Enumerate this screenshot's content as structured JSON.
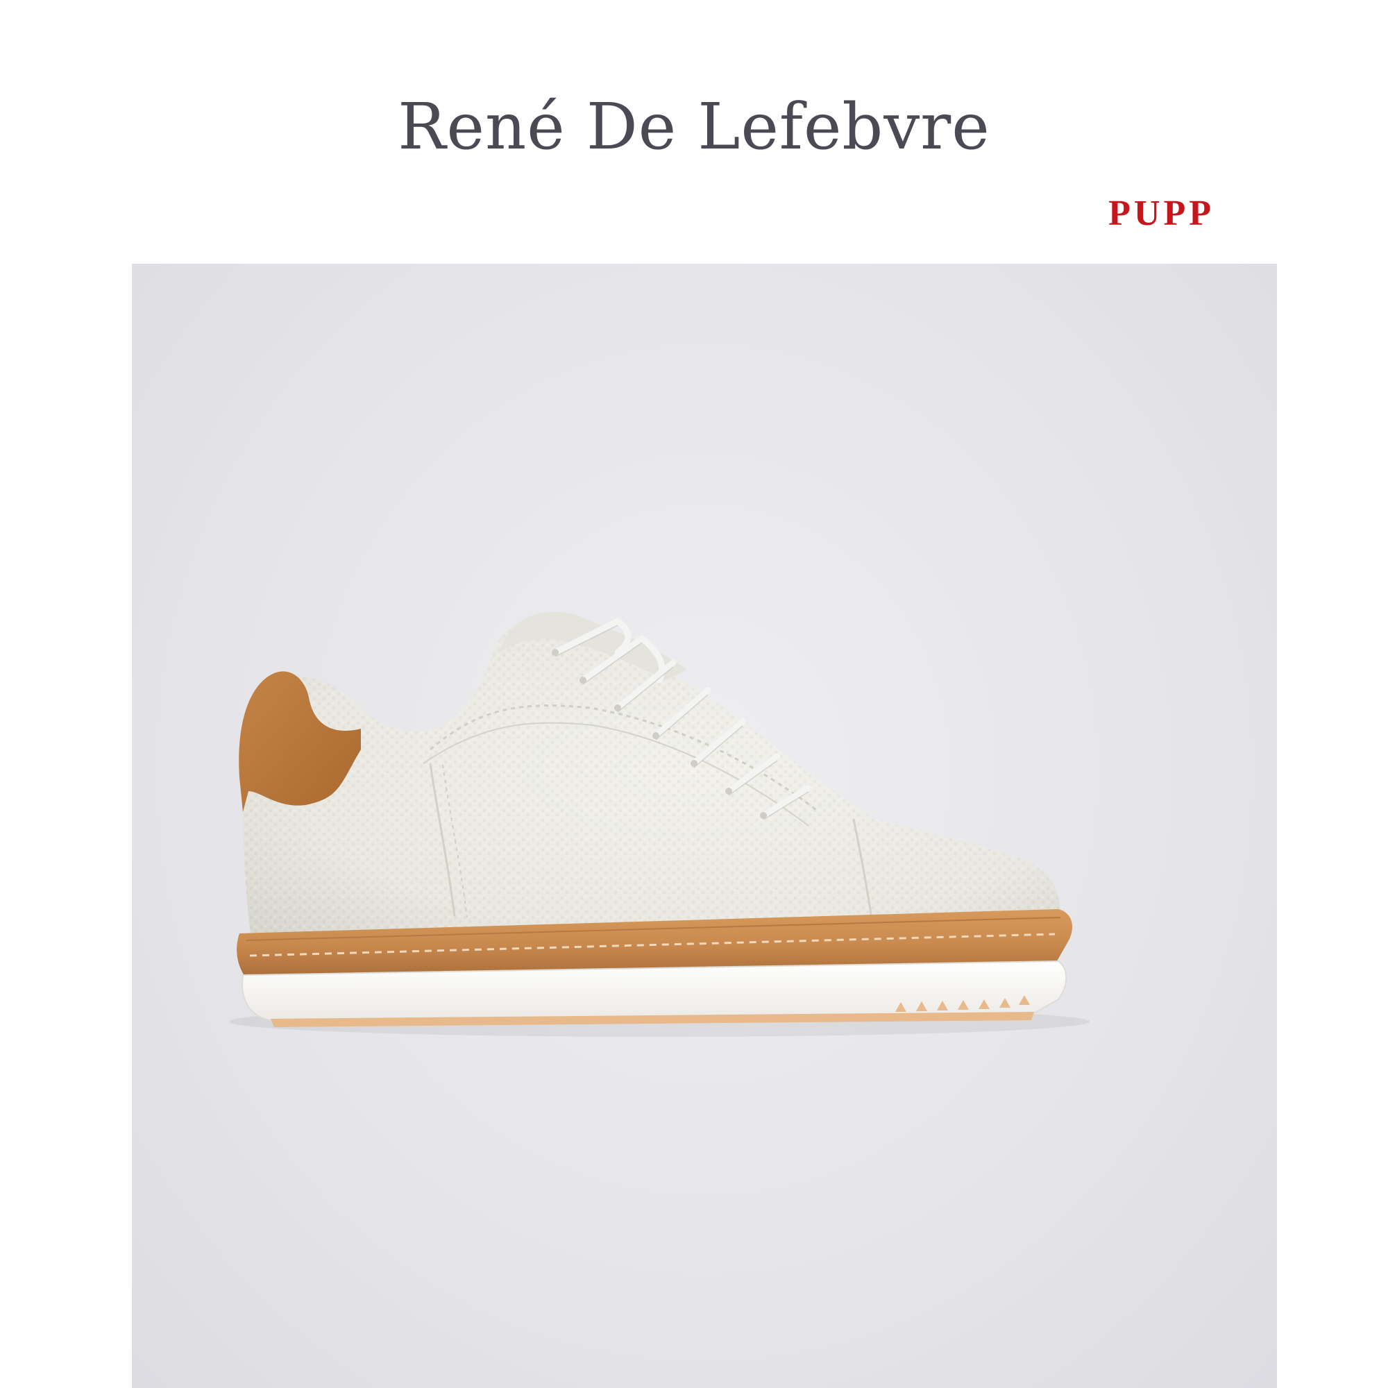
{
  "header": {
    "brand_name": "René De Lefebvre"
  },
  "store_logo": {
    "text": "PUPP",
    "color": "#c4161c"
  },
  "product_image": {
    "subject": "sneaker-icon",
    "upper_color": "#ecebe4",
    "heel_tab_color": "#b8773f",
    "welt_color": "#c98a4f",
    "sole_color": "#f6f5f2",
    "outsole_color": "#e7b98b",
    "background_color": "#e6e6ea"
  }
}
